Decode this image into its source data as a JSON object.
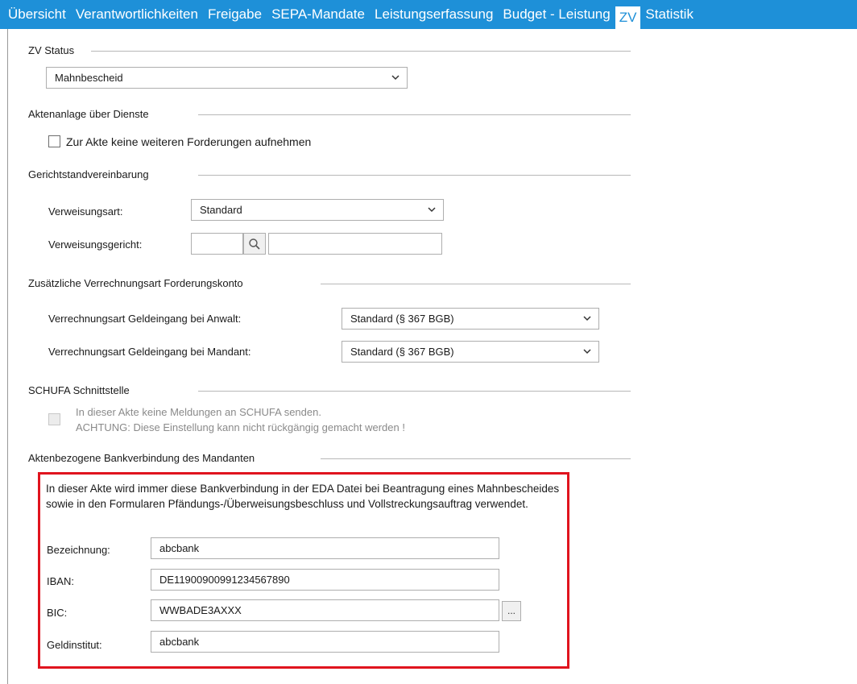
{
  "tabs": [
    {
      "label": "Übersicht",
      "active": false
    },
    {
      "label": "Verantwortlichkeiten",
      "active": false
    },
    {
      "label": "Freigabe",
      "active": false
    },
    {
      "label": "SEPA-Mandate",
      "active": false
    },
    {
      "label": "Leistungserfassung",
      "active": false
    },
    {
      "label": "Budget - Leistung",
      "active": false
    },
    {
      "label": "ZV",
      "active": true
    },
    {
      "label": "Statistik",
      "active": false
    }
  ],
  "colors": {
    "tab_bar": "#1e90d8",
    "highlight_border": "#e0141e"
  },
  "zv_status": {
    "title": "ZV Status",
    "selected": "Mahnbescheid"
  },
  "aktenanlage": {
    "title": "Aktenanlage über Dienste",
    "checkbox_label": "Zur Akte keine weiteren Forderungen aufnehmen",
    "checked": false
  },
  "gerichtstand": {
    "title": "Gerichtstandvereinbarung",
    "verweisungsart_label": "Verweisungsart:",
    "verweisungsart_value": "Standard",
    "verweisungsgericht_label": "Verweisungsgericht:",
    "verweisungsgericht_code": "",
    "verweisungsgericht_name": ""
  },
  "verrechnung": {
    "title": "Zusätzliche Verrechnungsart Forderungskonto",
    "anwalt_label": "Verrechnungsart Geldeingang bei Anwalt:",
    "anwalt_value": "Standard (§ 367 BGB)",
    "mandant_label": "Verrechnungsart Geldeingang bei Mandant:",
    "mandant_value": "Standard (§ 367 BGB)"
  },
  "schufa": {
    "title": "SCHUFA Schnittstelle",
    "line1": "In dieser Akte keine Meldungen an SCHUFA senden.",
    "line2": "ACHTUNG: Diese Einstellung kann nicht rückgängig gemacht werden !",
    "checked": false
  },
  "bank": {
    "title": "Aktenbezogene Bankverbindung des Mandanten",
    "info": "In dieser Akte wird immer diese Bankverbindung in der EDA Datei bei Beantragung eines Mahnbescheides sowie in den Formularen Pfändungs-/Überweisungsbeschluss und Vollstreckungsauftrag verwendet.",
    "bezeichnung_label": "Bezeichnung:",
    "bezeichnung_value": "abcbank",
    "iban_label": "IBAN:",
    "iban_value": "DE11900900991234567890",
    "bic_label": "BIC:",
    "bic_value": "WWBADE3AXXX",
    "bic_button": "...",
    "geldinstitut_label": "Geldinstitut:",
    "geldinstitut_value": "abcbank"
  }
}
